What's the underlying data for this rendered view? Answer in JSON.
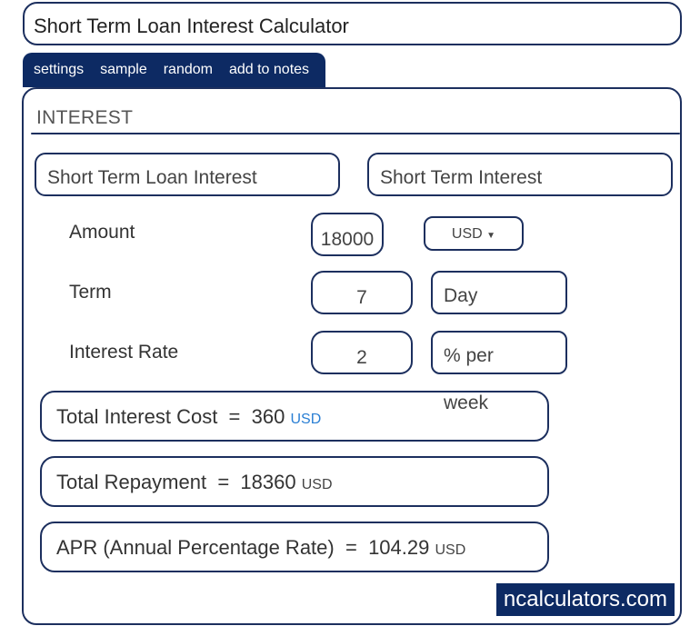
{
  "title": "Short Term Loan Interest Calculator",
  "tabs": [
    "settings",
    "sample",
    "random",
    "add to notes"
  ],
  "section_title": "INTEREST",
  "selectors": {
    "left": "Short Term Loan Interest",
    "right": "Short Term Interest"
  },
  "fields": {
    "amount": {
      "label": "Amount",
      "value": "18000",
      "unit": "USD"
    },
    "term": {
      "label": "Term",
      "value": "7",
      "unit": "Day"
    },
    "rate": {
      "label": "Interest Rate",
      "value": "2",
      "unit": "% per",
      "unit_wrap": "week"
    }
  },
  "results": [
    {
      "label": "Total Interest Cost",
      "eq": "=",
      "value": "360",
      "unit": "USD"
    },
    {
      "label": "Total Repayment",
      "eq": "=",
      "value": "18360",
      "unit": "USD"
    },
    {
      "label": "APR (Annual Percentage Rate)",
      "eq": "=",
      "value": "104.29",
      "unit": "USD"
    }
  ],
  "brand": "ncalculators.com",
  "colors": {
    "accent": "#0d2a63",
    "border": "#1c2f5e",
    "link": "#2a7fd4"
  }
}
